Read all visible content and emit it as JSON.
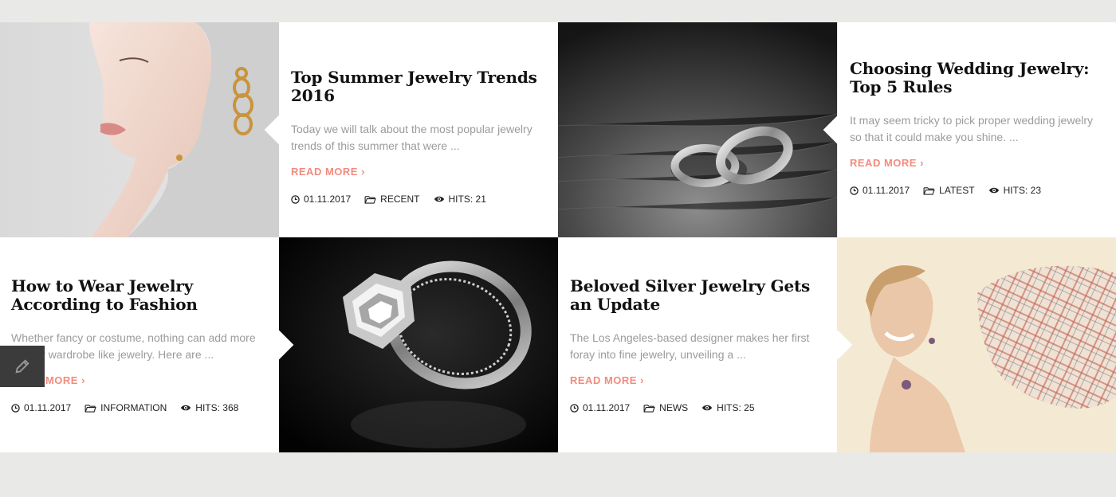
{
  "posts": [
    {
      "title": "Top Summer Jewelry Trends 2016",
      "excerpt": "Today we will talk about the most popular jewelry trends of this summer that were ...",
      "read_more": "READ MORE",
      "date": "01.11.2017",
      "category": "RECENT",
      "hits": "HITS: 21"
    },
    {
      "title": "Choosing Wedding Jewelry: Top 5 Rules",
      "excerpt": "It may seem tricky to pick proper wedding jewelry so that it could make you shine. ...",
      "read_more": "READ MORE",
      "date": "01.11.2017",
      "category": "LATEST",
      "hits": "HITS: 23"
    },
    {
      "title": "How to Wear Jewelry According to Fashion",
      "excerpt": "Whether fancy or costume, nothing can add more to your wardrobe like jewelry. Here are ...",
      "read_more": "READ MORE",
      "date": "01.11.2017",
      "category": "INFORMATION",
      "hits": "HITS: 368"
    },
    {
      "title": "Beloved Silver Jewelry Gets an Update",
      "excerpt": "The Los Angeles-based designer makes her first foray into fine jewelry, unveiling a ...",
      "read_more": "READ MORE",
      "date": "01.11.2017",
      "category": "NEWS",
      "hits": "HITS: 25"
    }
  ],
  "images": {
    "woman_earring": "woman-with-gold-earring-photo",
    "wedding_rings": "silver-wedding-rings-photo",
    "diamond_ring": "diamond-ring-photo",
    "woman_scarf": "smiling-woman-with-plaid-scarf-photo"
  },
  "colors": {
    "accent": "#f28b7d",
    "background": "#e9e9e7",
    "title": "#111111",
    "excerpt": "#9b9b9b",
    "edit_button": "#3b3b3b"
  },
  "icons": {
    "date": "clock-icon",
    "category": "folder-icon",
    "hits": "eye-icon",
    "read_more": "chevron-right-icon",
    "edit": "pencil-icon"
  }
}
